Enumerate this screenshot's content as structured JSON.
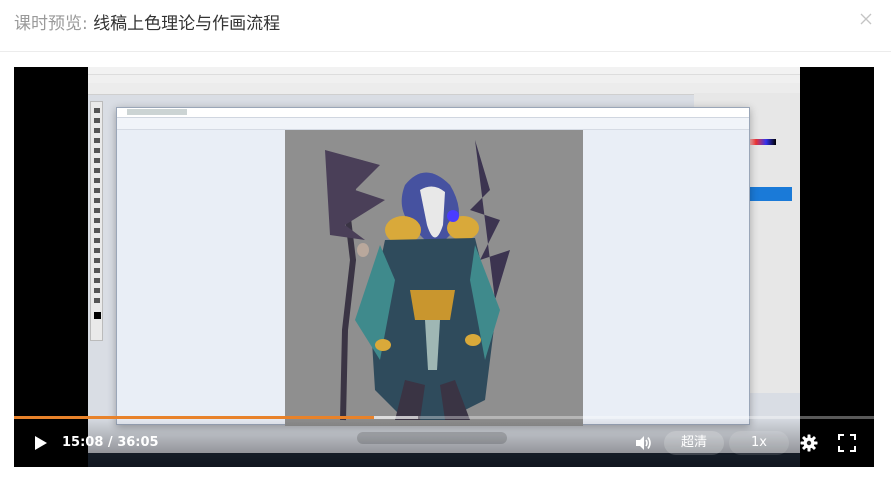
{
  "modal": {
    "title_prefix": "课时预览: ",
    "title": "线稿上色理论与作画流程",
    "close_icon": "close-icon"
  },
  "player": {
    "current_time": "15:08",
    "separator": " / ",
    "duration": "36:05",
    "progress_fraction": 0.419,
    "buffered_fraction": 0.47,
    "progress_color": "#e8822a",
    "quality_label": "超清",
    "speed_label": "1x",
    "icons": {
      "play": "play-icon",
      "volume": "volume-icon",
      "settings": "gear-icon",
      "fullscreen": "fullscreen-icon"
    }
  }
}
